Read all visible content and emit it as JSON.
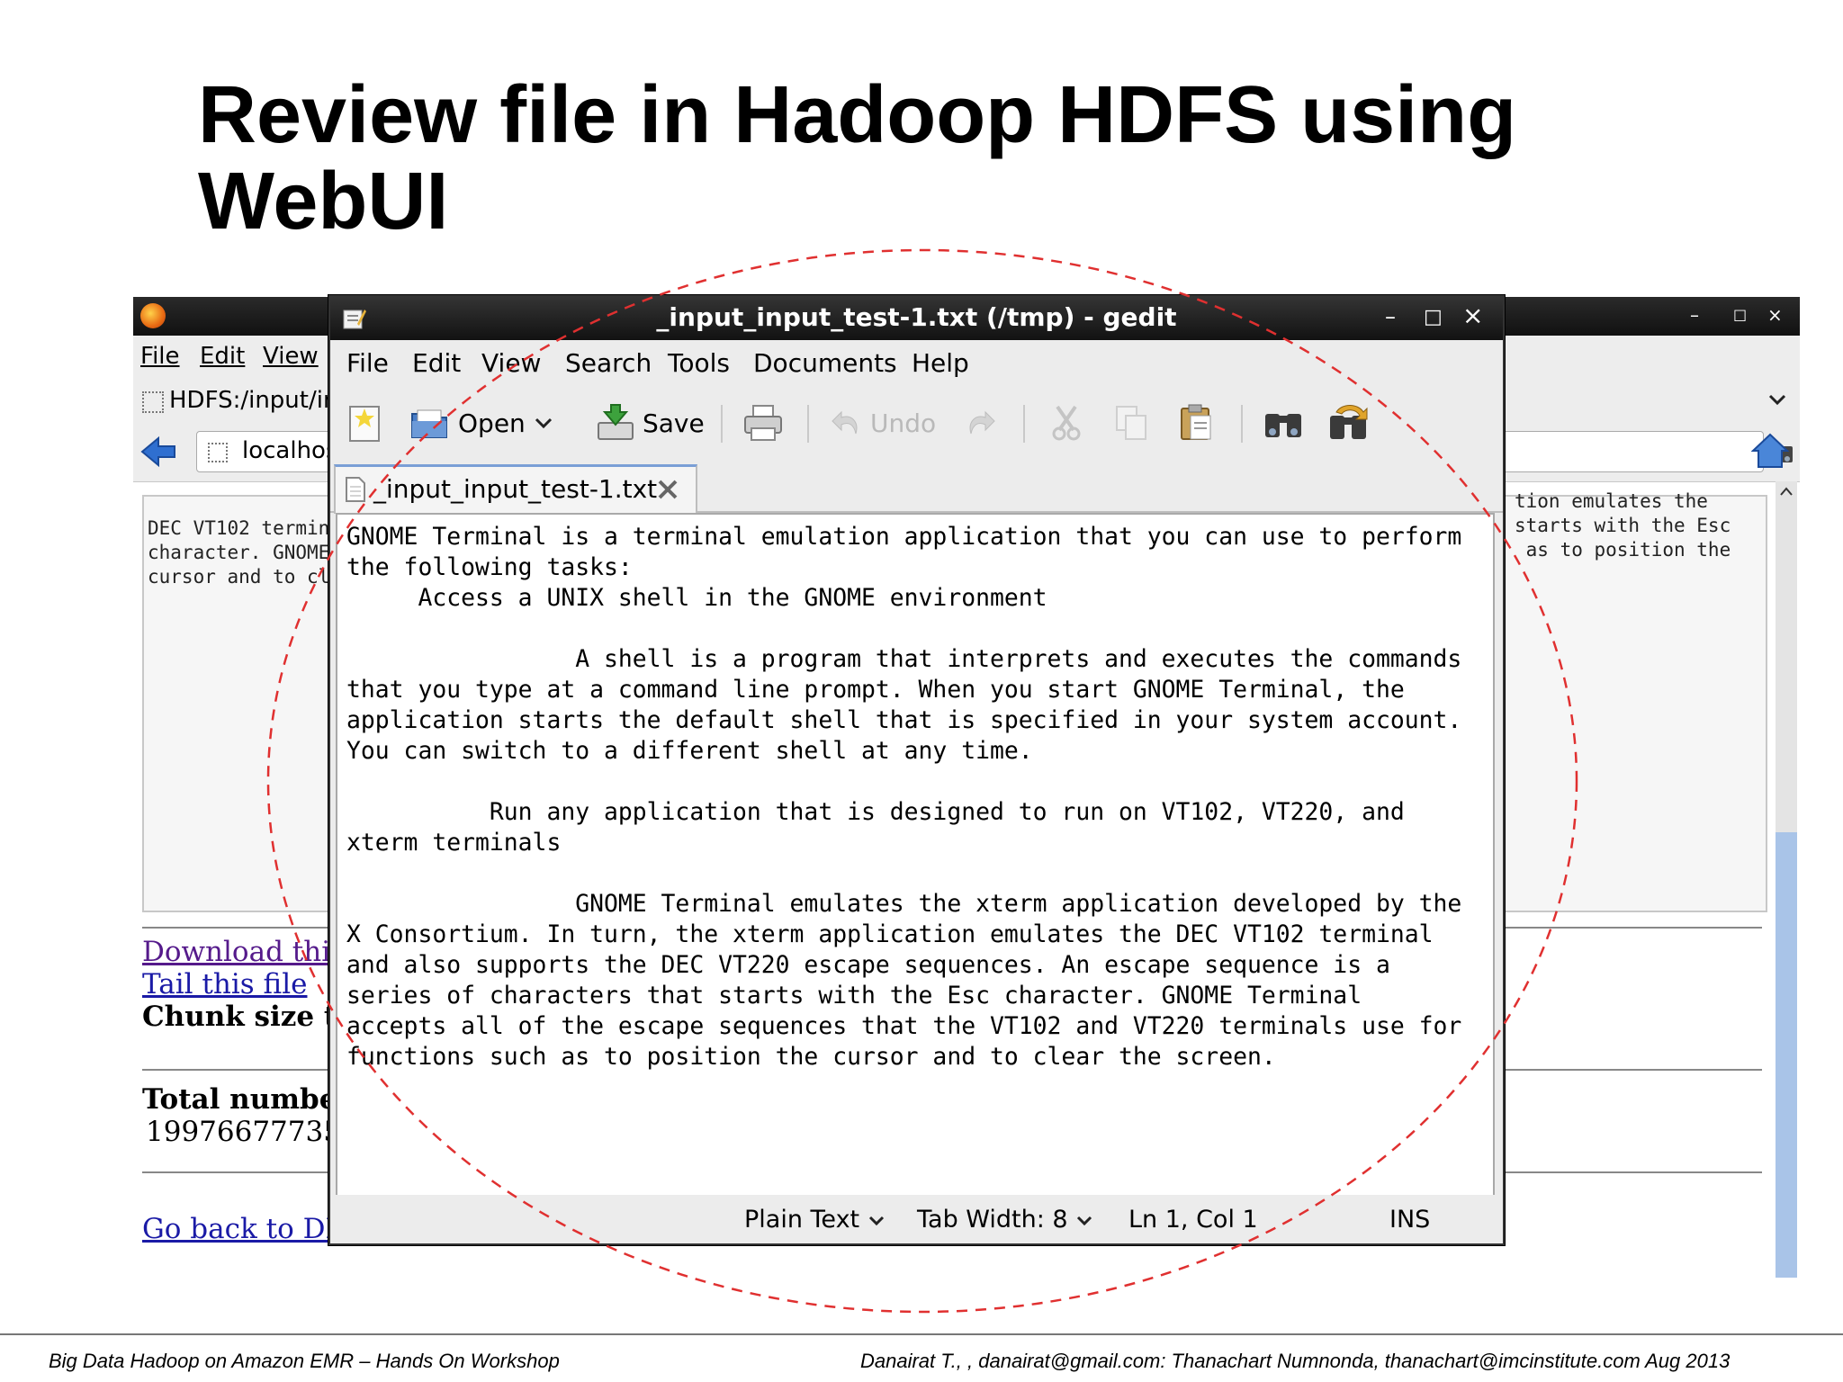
{
  "slide": {
    "title_line1": "Review file in Hadoop HDFS using",
    "title_line2": "WebUI",
    "footer_left": "Big Data Hadoop on Amazon EMR – Hands On Workshop",
    "footer_right": "Danairat T., , danairat@gmail.com:  Thanachart Numnonda,  thanachart@imcinstitute.com   Aug 2013"
  },
  "firefox": {
    "window_controls": {
      "minimize": "–",
      "maximize": "□",
      "close": "×"
    },
    "menu": [
      "File",
      "Edit",
      "View"
    ],
    "tab_label": "HDFS:/input/inp",
    "url_text": "localhos",
    "content_left": "DEC VT102 termin\ncharacter. GNOME\ncursor and to cl",
    "content_right": "tion emulates the\nstarts with the Esc\n as to position the",
    "download_link": "Download this",
    "tail_link": "Tail this file",
    "chunk_label": "Chunk size t",
    "total_label": "Total numbe",
    "total_value": "19976677735",
    "back_link": "Go back to DF"
  },
  "gedit": {
    "title": "_input_input_test-1.txt (/tmp) - gedit",
    "window_controls": {
      "minimize": "–",
      "maximize": "□",
      "close": "×"
    },
    "menu": [
      "File",
      "Edit",
      "View",
      "Search",
      "Tools",
      "Documents",
      "Help"
    ],
    "toolbar": {
      "open": "Open",
      "save": "Save",
      "undo": "Undo"
    },
    "tab_label": "_input_input_test-1.txt",
    "text": "GNOME Terminal is a terminal emulation application that you can use to perform\nthe following tasks:\n     Access a UNIX shell in the GNOME environment\n\n                A shell is a program that interprets and executes the commands\nthat you type at a command line prompt. When you start GNOME Terminal, the\napplication starts the default shell that is specified in your system account.\nYou can switch to a different shell at any time.\n\n          Run any application that is designed to run on VT102, VT220, and\nxterm terminals\n\n                GNOME Terminal emulates the xterm application developed by the\nX Consortium. In turn, the xterm application emulates the DEC VT102 terminal\nand also supports the DEC VT220 escape sequences. An escape sequence is a\nseries of characters that starts with the Esc character. GNOME Terminal\naccepts all of the escape sequences that the VT102 and VT220 terminals use for\nfunctions such as to position the cursor and to clear the screen.",
    "status": {
      "language": "Plain Text",
      "tab_width": "Tab Width:  8",
      "position": "Ln 1, Col 1",
      "mode": "INS"
    }
  },
  "colors": {
    "annotation": "#e03030",
    "title_bar": "#1a1a1a",
    "link": "#1a1aa6",
    "visited_link": "#551a8b"
  }
}
